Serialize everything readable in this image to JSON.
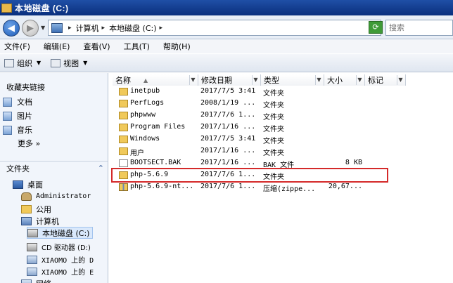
{
  "window": {
    "title": "本地磁盘 (C:)"
  },
  "address": {
    "crumbs": [
      "计算机",
      "本地磁盘 (C:)"
    ],
    "search_placeholder": "搜索"
  },
  "menu": [
    "文件(F)",
    "编辑(E)",
    "查看(V)",
    "工具(T)",
    "帮助(H)"
  ],
  "toolbar": {
    "organize": "组织",
    "views": "视图"
  },
  "favorites": {
    "title": "收藏夹链接",
    "items": [
      "文档",
      "图片",
      "音乐"
    ],
    "more": "更多 »"
  },
  "tree": {
    "header": "文件夹",
    "nodes": [
      {
        "label": "桌面",
        "icon": "desktop-icon"
      },
      {
        "label": "Administrator",
        "icon": "user-folder-icon"
      },
      {
        "label": "公用",
        "icon": "folder-icon"
      },
      {
        "label": "计算机",
        "icon": "computer-icon"
      },
      {
        "label": "本地磁盘 (C:)",
        "icon": "drive-icon",
        "selected": true
      },
      {
        "label": "CD 驱动器 (D:)",
        "icon": "cd-drive-icon"
      },
      {
        "label": "XIAOMO 上的 D",
        "icon": "network-drive-icon"
      },
      {
        "label": "XIAOMO 上的 E",
        "icon": "network-drive-icon"
      },
      {
        "label": "网络",
        "icon": "network-icon"
      }
    ]
  },
  "columns": [
    "名称",
    "修改日期",
    "类型",
    "大小",
    "标记"
  ],
  "files": [
    {
      "name": "inetpub",
      "date": "2017/7/5 3:41",
      "type": "文件夹",
      "size": "",
      "icon": "folder"
    },
    {
      "name": "PerfLogs",
      "date": "2008/1/19 ...",
      "type": "文件夹",
      "size": "",
      "icon": "folder"
    },
    {
      "name": "phpwww",
      "date": "2017/7/6 1...",
      "type": "文件夹",
      "size": "",
      "icon": "folder"
    },
    {
      "name": "Program Files",
      "date": "2017/1/16 ...",
      "type": "文件夹",
      "size": "",
      "icon": "folder"
    },
    {
      "name": "Windows",
      "date": "2017/7/5 3:41",
      "type": "文件夹",
      "size": "",
      "icon": "folder"
    },
    {
      "name": "用户",
      "date": "2017/1/16 ...",
      "type": "文件夹",
      "size": "",
      "icon": "folder"
    },
    {
      "name": "BOOTSECT.BAK",
      "date": "2017/1/16 ...",
      "type": "BAK 文件",
      "size": "8 KB",
      "icon": "file"
    },
    {
      "name": "php-5.6.9",
      "date": "2017/7/6 1...",
      "type": "文件夹",
      "size": "",
      "icon": "folder"
    },
    {
      "name": "php-5.6.9-nt...",
      "date": "2017/7/6 1...",
      "type": "压缩(zippe...",
      "size": "20,67...",
      "icon": "zip"
    }
  ]
}
